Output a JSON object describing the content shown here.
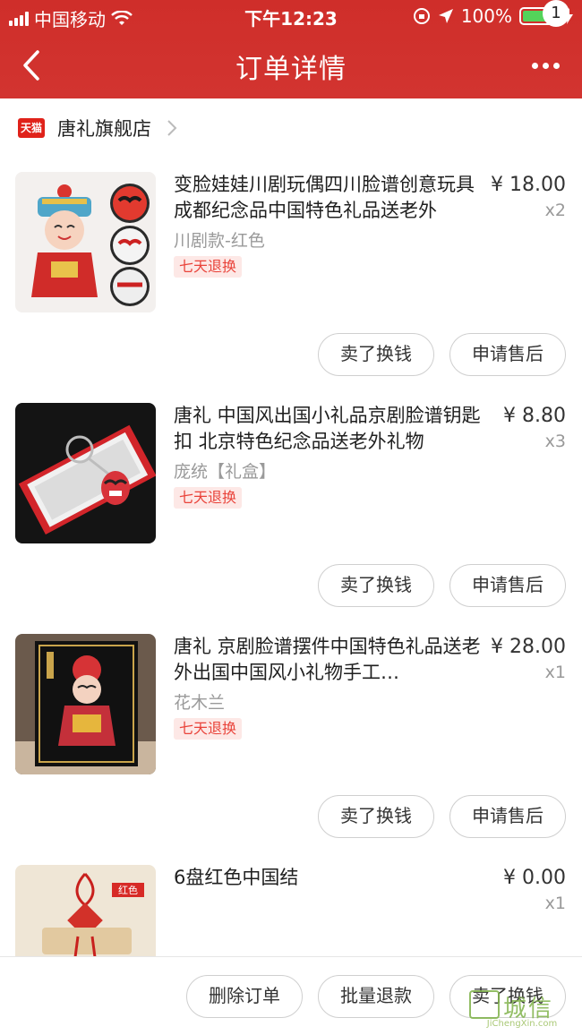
{
  "status_bar": {
    "carrier": "中国移动",
    "time": "下午12:23",
    "battery": "100%"
  },
  "nav": {
    "title": "订单详情",
    "badge_count": "1"
  },
  "store": {
    "platform": "天猫",
    "name": "唐礼旗舰店"
  },
  "items": [
    {
      "title": "变脸娃娃川剧玩偶四川脸谱创意玩具成都纪念品中国特色礼品送老外",
      "variant": "川剧款-红色",
      "tag": "七天退换",
      "price": "¥ 18.00",
      "qty": "x2",
      "buttons": [
        "卖了换钱",
        "申请售后"
      ]
    },
    {
      "title": "唐礼 中国风出国小礼品京剧脸谱钥匙扣 北京特色纪念品送老外礼物",
      "variant": "庞统【礼盒】",
      "tag": "七天退换",
      "price": "¥ 8.80",
      "qty": "x3",
      "buttons": [
        "卖了换钱",
        "申请售后"
      ]
    },
    {
      "title": "唐礼 京剧脸谱摆件中国特色礼品送老外出国中国风小礼物手工…",
      "variant": "花木兰",
      "tag": "七天退换",
      "price": "¥ 28.00",
      "qty": "x1",
      "buttons": [
        "卖了换钱",
        "申请售后"
      ]
    },
    {
      "title": "6盘红色中国结",
      "thumb_label": "红色",
      "price": "¥ 0.00",
      "qty": "x1"
    }
  ],
  "bottom_bar": {
    "buttons": [
      "删除订单",
      "批量退款",
      "卖了换钱"
    ]
  },
  "watermark": {
    "text": "城信",
    "sub": "JiChengXin.com"
  },
  "colors": {
    "header": "#d23430",
    "tag_bg": "#fde8e6",
    "tag_text": "#e9433a"
  }
}
